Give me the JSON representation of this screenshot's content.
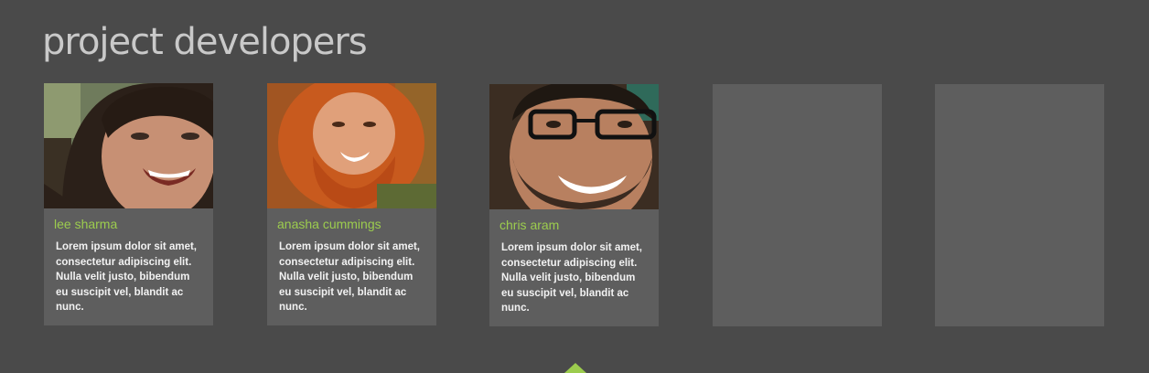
{
  "page": {
    "title": "project developers"
  },
  "developers": [
    {
      "name": "lee sharma",
      "bio": "Lorem ipsum dolor sit amet, consectetur adipiscing elit. Nulla velit justo, bibendum eu suscipit vel, blandit ac nunc.",
      "photo": "portrait-photo"
    },
    {
      "name": "anasha cummings",
      "bio": "Lorem ipsum dolor sit amet, consectetur adipiscing elit. Nulla velit justo, bibendum eu suscipit vel, blandit ac nunc.",
      "photo": "portrait-photo"
    },
    {
      "name": "chris aram",
      "bio": "Lorem ipsum dolor sit amet, consectetur adipiscing elit. Nulla velit justo, bibendum eu suscipit vel, blandit ac nunc.",
      "photo": "portrait-photo"
    }
  ],
  "colors": {
    "background": "#4a4a4a",
    "card": "#5e5e5e",
    "accent": "#9ccc4e",
    "title": "#c9c9c9"
  },
  "icons": {
    "pager": "triangle-up-indicator"
  }
}
